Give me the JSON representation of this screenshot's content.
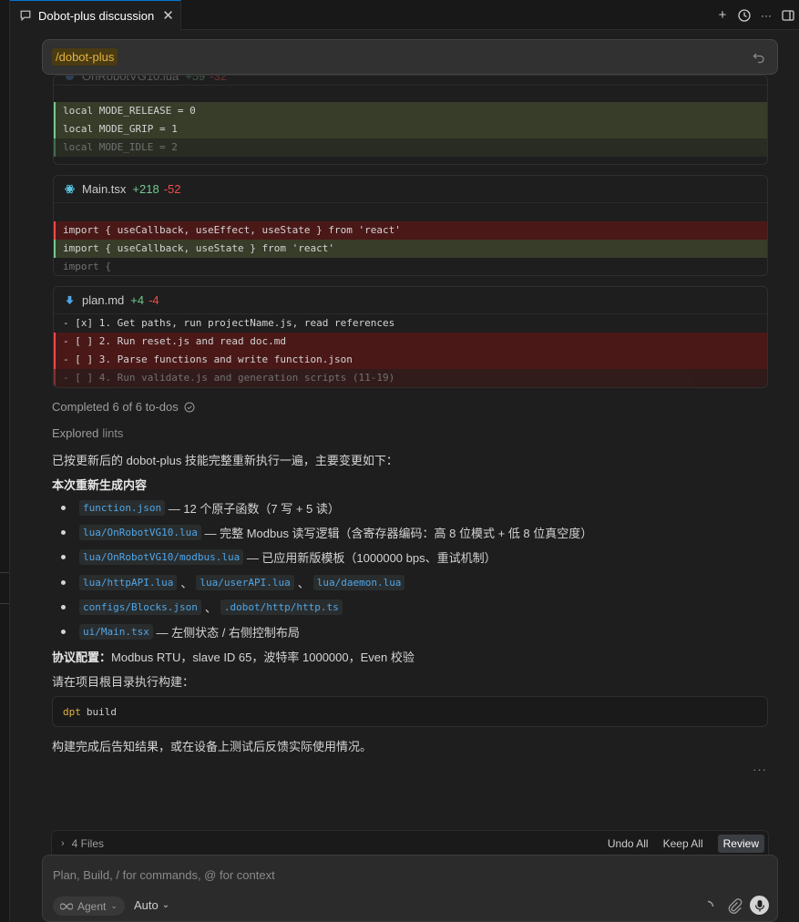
{
  "tab": {
    "title": "Dobot-plus discussion",
    "close": "✕"
  },
  "tab_actions": {
    "new": "+",
    "history": "⏱",
    "more": "···"
  },
  "command": {
    "chip": "/dobot-plus"
  },
  "cards": [
    {
      "file": "OnRobotVG10.lua",
      "added": "+59",
      "removed": "-32",
      "lines": [
        {
          "type": "add",
          "text": "local MODE_RELEASE = 0"
        },
        {
          "type": "add",
          "text": "local MODE_GRIP = 1"
        },
        {
          "type": "add-fade",
          "text": "local MODE_IDLE = 2"
        }
      ]
    },
    {
      "file": "Main.tsx",
      "added": "+218",
      "removed": "-52",
      "lines": [
        {
          "type": "del",
          "text": "import { useCallback, useEffect, useState } from 'react'"
        },
        {
          "type": "add",
          "text": "import { useCallback, useState } from 'react'"
        },
        {
          "type": "fade",
          "text": "import {"
        }
      ]
    },
    {
      "file": "plan.md",
      "added": "+4",
      "removed": "-4",
      "lines": [
        {
          "type": "ctx",
          "text": "- [x] 1. Get paths, run projectName.js, read references"
        },
        {
          "type": "del",
          "text": "- [ ] 2. Run reset.js and read doc.md"
        },
        {
          "type": "del",
          "text": "- [ ] 3. Parse functions and write function.json"
        },
        {
          "type": "del-fade",
          "text": "- [ ] 4. Run validate.js and generation scripts (11-19)"
        }
      ]
    }
  ],
  "status": {
    "completed": "Completed 6 of 6 to-dos",
    "explored_prefix": "Explored",
    "explored_link": "lints"
  },
  "message": {
    "intro": "已按更新后的 dobot-plus 技能完整重新执行一遍，主要变更如下：",
    "section_title": "本次重新生成内容",
    "bullets": [
      {
        "codes": [
          "function.json"
        ],
        "text": "— 12 个原子函数（7 写 + 5 读）"
      },
      {
        "codes": [
          "lua/OnRobotVG10.lua"
        ],
        "text": "— 完整 Modbus 读写逻辑（含寄存器编码：高 8 位模式 + 低 8 位真空度）"
      },
      {
        "codes": [
          "lua/OnRobotVG10/modbus.lua"
        ],
        "text": "— 已应用新版模板（1000000 bps、重试机制）"
      },
      {
        "codes": [
          "lua/httpAPI.lua",
          "lua/userAPI.lua",
          "lua/daemon.lua"
        ],
        "text": ""
      },
      {
        "codes": [
          "configs/Blocks.json",
          ".dobot/http/http.ts"
        ],
        "text": ""
      },
      {
        "codes": [
          "ui/Main.tsx"
        ],
        "text": "— 左侧状态 / 右侧控制布局"
      }
    ],
    "protocol_label": "协议配置：",
    "protocol_text": "Modbus RTU，slave ID 65，波特率 1000000，Even 校验",
    "build_intro": "请在项目根目录执行构建：",
    "build_cmd": "dpt",
    "build_arg": "build",
    "outro": "构建完成后告知结果，或在设备上测试后反馈实际使用情况。",
    "separator": "、"
  },
  "files_bar": {
    "label": "4 Files",
    "undo": "Undo All",
    "keep": "Keep All",
    "review": "Review"
  },
  "composer": {
    "placeholder": "Plan, Build, / for commands, @ for context",
    "agent": "Agent",
    "mode": "Auto"
  },
  "colors": {
    "accent": "#0078d4",
    "add": "#73c991",
    "del": "#f14c4c",
    "chip": "#e3b341"
  }
}
